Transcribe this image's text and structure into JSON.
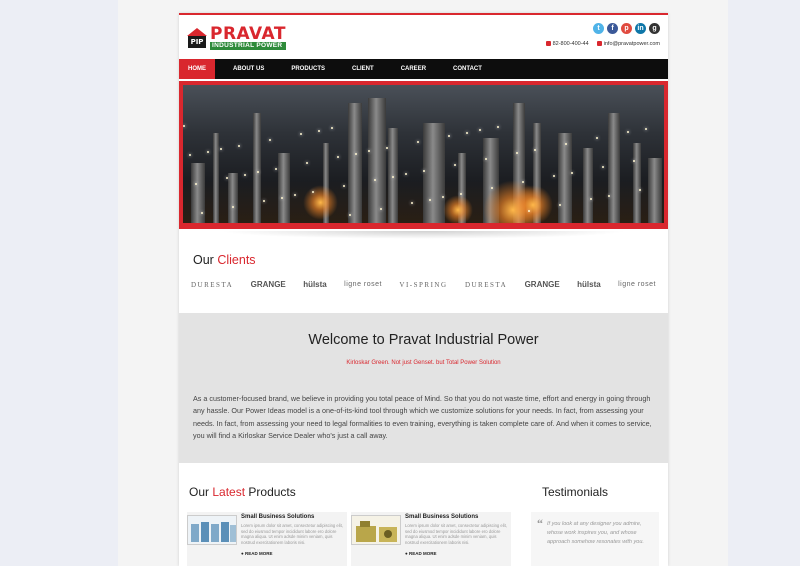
{
  "brand": {
    "logo_mark": "PIP",
    "name": "PRAVAT",
    "subtitle": "INDUSTRIAL POWER",
    "accent": "#d9272e",
    "green": "#2e8b3a"
  },
  "social": [
    {
      "name": "twitter-icon",
      "glyph": "t",
      "color": "#4fb3e8"
    },
    {
      "name": "facebook-icon",
      "glyph": "f",
      "color": "#3b5998"
    },
    {
      "name": "pinterest-icon",
      "glyph": "p",
      "color": "#e04a3f"
    },
    {
      "name": "linkedin-icon",
      "glyph": "in",
      "color": "#0e76a8"
    },
    {
      "name": "googleplus-icon",
      "glyph": "g",
      "color": "#333333"
    }
  ],
  "contact": {
    "phone": "82-800-400-44",
    "email": "info@pravatpower.com"
  },
  "nav": {
    "items": [
      "HOME",
      "ABOUT US",
      "PRODUCTS",
      "CLIENT",
      "CAREER",
      "CONTACT"
    ],
    "active": "HOME"
  },
  "clients": {
    "title_prefix": "Our",
    "title_highlight": "Clients",
    "logos": [
      "DURESTA",
      "GRANGE",
      "hülsta",
      "ligne roset",
      "VI-SPRING",
      "DURESTA",
      "GRANGE",
      "hülsta",
      "ligne roset"
    ]
  },
  "welcome": {
    "heading": "Welcome to Pravat Industrial Power",
    "tagline": "Kirloskar Green. Not just Genset. but Total Power Solution",
    "body": "As a customer-focused brand, we believe in providing you total peace of Mind. So that you do not waste time, effort and energy in going through any hassle. Our Power Ideas model is a one-of-its-kind tool through which we customize solutions for your needs. In fact, from assessing your needs. In fact, from assessing your need to legal formalities to even training, everything is taken complete care of. And when it comes to service, you will find a Kirloskar Service Dealer who's just a call away."
  },
  "products": {
    "title_prefix": "Our",
    "title_highlight": "Latest",
    "title_suffix": "Products",
    "items": [
      {
        "title": "Small Business Solutions",
        "desc": "Lorem ipsum dolor sit amet, consectetur adipiscing elit, sed do eiusmod tempor incididunt labore ero dolore magna aliqua. Ut enim adsde minim veniam, quis nostrud exercitationem laboris nisi.",
        "more": "READ MORE"
      },
      {
        "title": "Small Business Solutions",
        "desc": "Lorem ipsum dolor sit amet, consectetur adipiscing elit, sed do eiusmod tempor incididunt labore ero dolore magna aliqua. Ut enim adsde minim veniam, quis nostrud exercitationem laboris nisi.",
        "more": "READ MORE"
      }
    ]
  },
  "testimonials": {
    "title": "Testimonials",
    "quote": "If you look at any designer you admire, whose work inspires you, and whose approach somehow resonates with you."
  }
}
